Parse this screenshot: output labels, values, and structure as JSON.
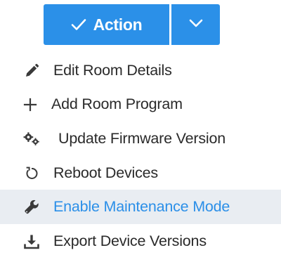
{
  "action_button": {
    "label": "Action",
    "color": "#2b90e8"
  },
  "menu": {
    "items": [
      {
        "label": "Edit Room Details",
        "icon": "pencil-icon",
        "active": false
      },
      {
        "label": "Add Room Program",
        "icon": "plus-icon",
        "active": false
      },
      {
        "label": "Update Firmware Version",
        "icon": "gears-icon",
        "active": false
      },
      {
        "label": "Reboot Devices",
        "icon": "reboot-icon",
        "active": false
      },
      {
        "label": "Enable Maintenance Mode",
        "icon": "wrench-icon",
        "active": true
      },
      {
        "label": "Export Device Versions",
        "icon": "download-icon",
        "active": false
      }
    ],
    "active_color": "#2b8fe8",
    "active_background": "#e9edf2"
  }
}
